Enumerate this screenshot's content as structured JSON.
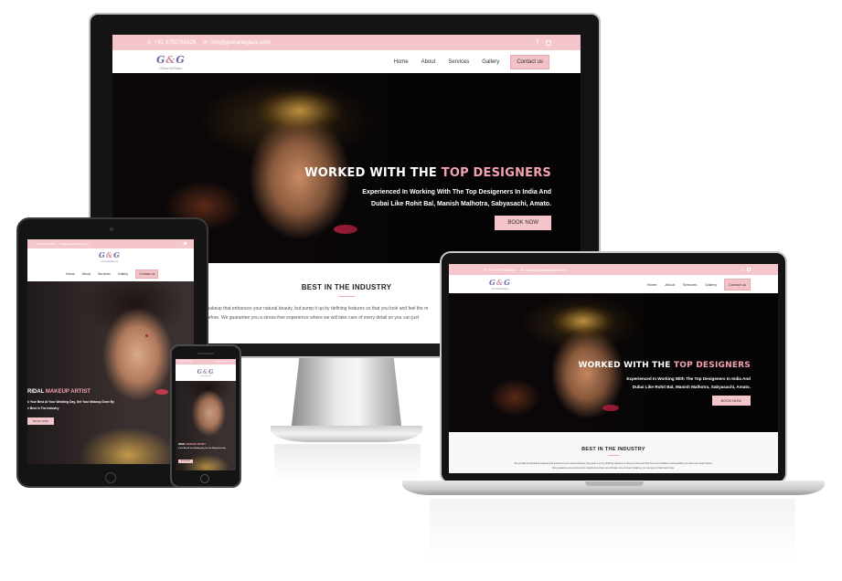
{
  "site": {
    "topbar": {
      "phone": "+91 9702765526",
      "email": "info@glowandglaze.com"
    },
    "logo": {
      "mark_g1": "G",
      "mark_amp": "&",
      "mark_g2": "G",
      "wordmark": "Glow&Glaze",
      "tagline": "Makeup & Hair Studio"
    },
    "nav": [
      "Home",
      "About",
      "Services",
      "Gallery"
    ],
    "contact_button": "Contact us",
    "hero_desktop": {
      "headline_a": "WORKED WITH THE",
      "headline_b": "TOP DESIGNERS",
      "subline_1": "Experienced In Working With The Top Desigeners In India And",
      "subline_2": "Dubai Like Rohit Bal, Manish Malhotra, Sabyasachi, Amato.",
      "button": "BOOK NOW"
    },
    "hero_tablet": {
      "headline_a": "RIDAL",
      "headline_b": "MAKEUP ARTIST",
      "subline_1": "k Your Best At Your Wedding Day, Get Your Makeup Done By",
      "subline_2": "e Best In The Industry",
      "button": "BOOK NOW"
    },
    "section": {
      "title": "BEST IN THE INDUSTRY",
      "para_1": "makeup that enhances your natural beauty, but pump it up by defining features so that you look and feel the m",
      "para_2": "before. We guarantee you a stress-free experience where we will take care of every detail so you can just",
      "para_1_full": "We provide professional makeup that enhances your natural beauty, but pump it up by defining features so that you look and feel the most confident and beautiful you have ever been before.",
      "para_2_full": "We guarantee you a stress-free experience where we will take care of every detail so you can just sit back and relax."
    },
    "social_icons": [
      "facebook-icon",
      "instagram-icon"
    ]
  },
  "colors": {
    "pink": "#f4c6cc",
    "accent": "#f2a3b0",
    "dark": "#0b0708"
  }
}
